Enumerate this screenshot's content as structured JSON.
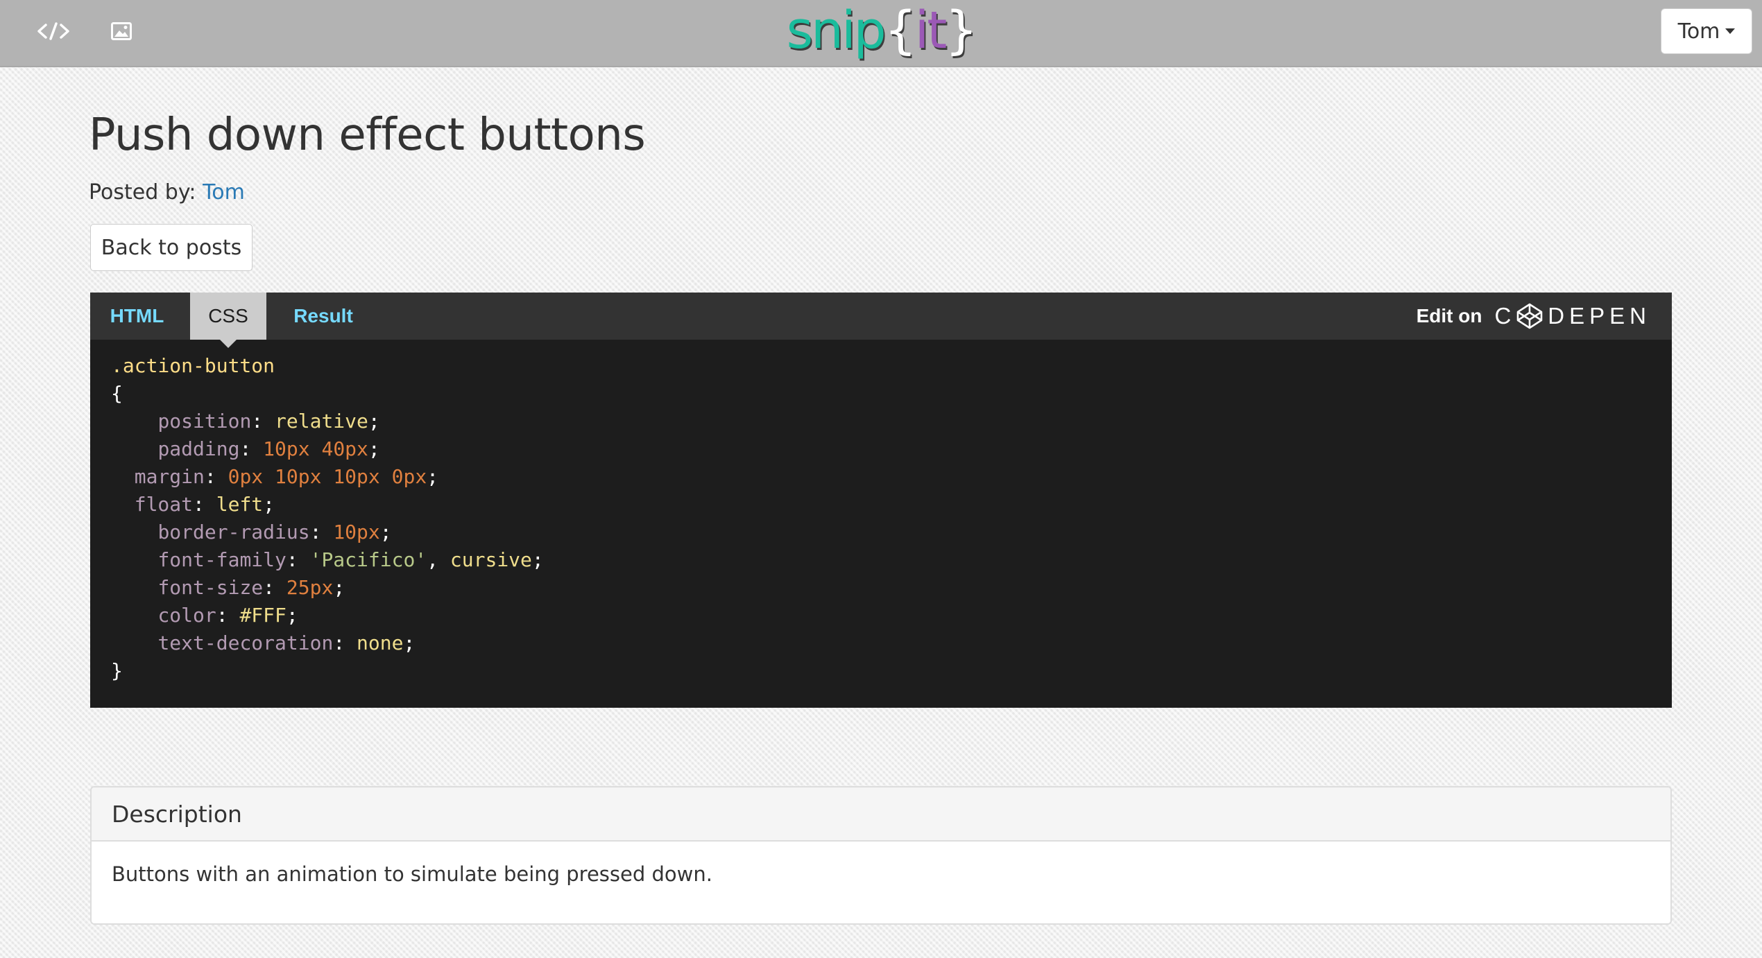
{
  "nav": {
    "code_icon": "code-icon",
    "image_icon": "image-icon",
    "logo": {
      "part1": "snip",
      "open": "{",
      "part2": "it",
      "close": "}"
    },
    "user": "Tom"
  },
  "post": {
    "title": "Push down effect buttons",
    "posted_by_label": "Posted by:",
    "author": "Tom",
    "back_label": "Back to posts"
  },
  "codepen": {
    "tabs": [
      {
        "label": "HTML",
        "active": false
      },
      {
        "label": "CSS",
        "active": true
      },
      {
        "label": "Result",
        "active": false
      }
    ],
    "edit_on": "Edit on",
    "logo_text": "DEPEN",
    "code": [
      {
        "indent": "",
        "tokens": [
          {
            "t": ".action-button",
            "c": "sel"
          }
        ]
      },
      {
        "indent": "",
        "tokens": [
          {
            "t": "{",
            "c": "pun"
          }
        ]
      },
      {
        "indent": "    ",
        "tokens": [
          {
            "t": "position",
            "c": "prop"
          },
          {
            "t": ": ",
            "c": "pun"
          },
          {
            "t": "relative",
            "c": "kw"
          },
          {
            "t": ";",
            "c": "pun"
          }
        ]
      },
      {
        "indent": "    ",
        "tokens": [
          {
            "t": "padding",
            "c": "prop"
          },
          {
            "t": ": ",
            "c": "pun"
          },
          {
            "t": "10px 40px",
            "c": "num"
          },
          {
            "t": ";",
            "c": "pun"
          }
        ]
      },
      {
        "indent": "  ",
        "tokens": [
          {
            "t": "margin",
            "c": "prop"
          },
          {
            "t": ": ",
            "c": "pun"
          },
          {
            "t": "0px 10px 10px 0px",
            "c": "num"
          },
          {
            "t": ";",
            "c": "pun"
          }
        ]
      },
      {
        "indent": "  ",
        "tokens": [
          {
            "t": "float",
            "c": "prop"
          },
          {
            "t": ": ",
            "c": "pun"
          },
          {
            "t": "left",
            "c": "kw"
          },
          {
            "t": ";",
            "c": "pun"
          }
        ]
      },
      {
        "indent": "    ",
        "tokens": [
          {
            "t": "border-radius",
            "c": "prop"
          },
          {
            "t": ": ",
            "c": "pun"
          },
          {
            "t": "10px",
            "c": "num"
          },
          {
            "t": ";",
            "c": "pun"
          }
        ]
      },
      {
        "indent": "    ",
        "tokens": [
          {
            "t": "font-family",
            "c": "prop"
          },
          {
            "t": ": ",
            "c": "pun"
          },
          {
            "t": "'Pacifico'",
            "c": "str"
          },
          {
            "t": ", ",
            "c": "pun"
          },
          {
            "t": "cursive",
            "c": "kw"
          },
          {
            "t": ";",
            "c": "pun"
          }
        ]
      },
      {
        "indent": "    ",
        "tokens": [
          {
            "t": "font-size",
            "c": "prop"
          },
          {
            "t": ": ",
            "c": "pun"
          },
          {
            "t": "25px",
            "c": "num"
          },
          {
            "t": ";",
            "c": "pun"
          }
        ]
      },
      {
        "indent": "    ",
        "tokens": [
          {
            "t": "color",
            "c": "prop"
          },
          {
            "t": ": ",
            "c": "pun"
          },
          {
            "t": "#FFF",
            "c": "kw"
          },
          {
            "t": ";",
            "c": "pun"
          }
        ]
      },
      {
        "indent": "    ",
        "tokens": [
          {
            "t": "text-decoration",
            "c": "prop"
          },
          {
            "t": ": ",
            "c": "pun"
          },
          {
            "t": "none",
            "c": "kw"
          },
          {
            "t": ";",
            "c": "pun"
          }
        ]
      },
      {
        "indent": "",
        "tokens": [
          {
            "t": "}",
            "c": "pun"
          }
        ]
      }
    ]
  },
  "description": {
    "heading": "Description",
    "body": "Buttons with an animation to simulate being pressed down."
  },
  "colors": {
    "topbar": "#b3b3b3",
    "logo_teal": "#1abc9c",
    "logo_purple": "#9b59b6",
    "link": "#2a7ab5",
    "codepen_bg": "#1d1d1d",
    "tab_link": "#76daff"
  }
}
